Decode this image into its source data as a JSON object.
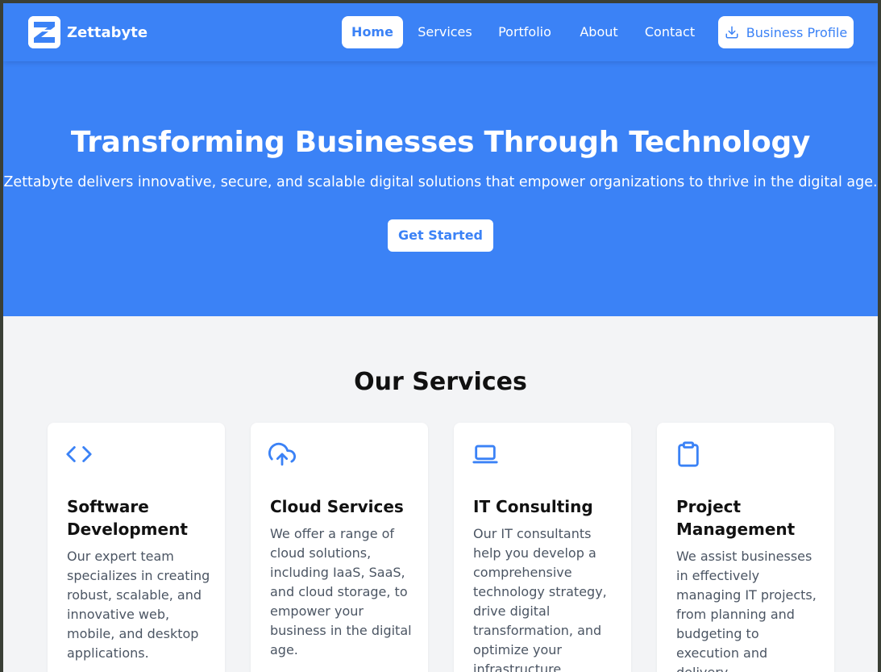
{
  "brand": {
    "name": "Zettabyte",
    "accent_color": "#3b82f6",
    "logo_icon": "z-logo-icon"
  },
  "nav": {
    "items": [
      {
        "label": "Home",
        "active": true
      },
      {
        "label": "Services",
        "active": false
      },
      {
        "label": "Portfolio",
        "active": false
      },
      {
        "label": "About",
        "active": false
      },
      {
        "label": "Contact",
        "active": false
      }
    ],
    "profile_button": {
      "label": "Business Profile",
      "icon": "download-icon"
    }
  },
  "hero": {
    "title": "Transforming Businesses Through Technology",
    "subtitle": "Zettabyte delivers innovative, secure, and scalable digital solutions that empower organizations to thrive in the digital age.",
    "cta_label": "Get Started"
  },
  "services": {
    "title": "Our Services",
    "cards": [
      {
        "icon": "code-icon",
        "title": "Software Development",
        "description": "Our expert team specializes in creating robust, scalable, and innovative web, mobile, and desktop applications."
      },
      {
        "icon": "cloud-upload-icon",
        "title": "Cloud Services",
        "description": "We offer a range of cloud solutions, including IaaS, SaaS, and cloud storage, to empower your business in the digital age."
      },
      {
        "icon": "laptop-icon",
        "title": "IT Consulting",
        "description": "Our IT consultants help you develop a comprehensive technology strategy, drive digital transformation, and optimize your infrastructure."
      },
      {
        "icon": "clipboard-icon",
        "title": "Project Management",
        "description": "We assist businesses in effectively managing IT projects, from planning and budgeting to execution and delivery."
      }
    ]
  }
}
